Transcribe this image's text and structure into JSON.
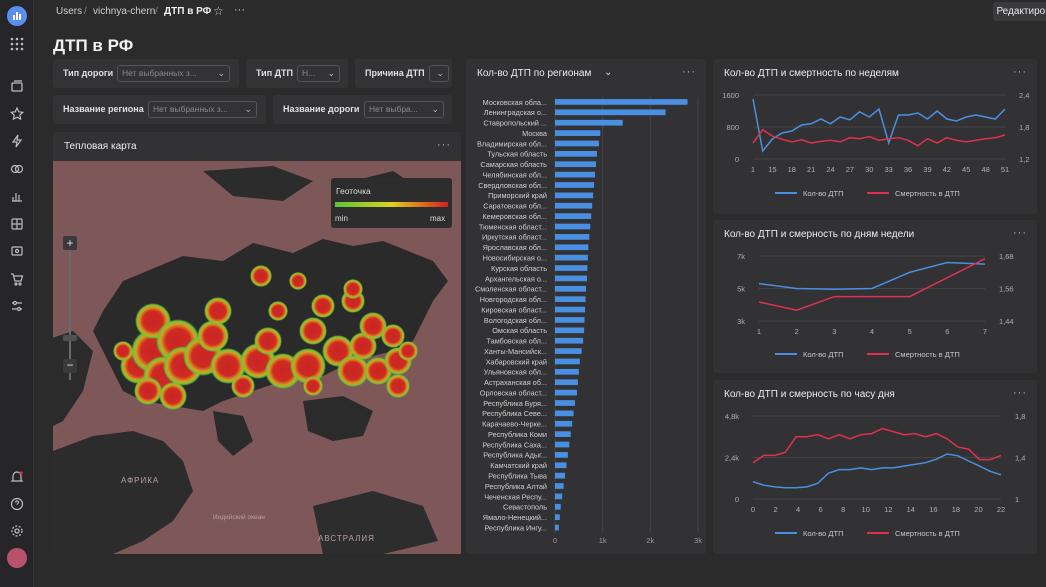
{
  "breadcrumbs": [
    "Users",
    "vichnya-chern",
    "ДТП в РФ"
  ],
  "topbar": {
    "edit_label": "Редактировать",
    "more_label": "···"
  },
  "page": {
    "title": "ДТП в РФ"
  },
  "filters": [
    {
      "label": "Тип дороги",
      "placeholder": "Нет выбранных з..."
    },
    {
      "label": "Тип ДТП",
      "placeholder": "Н..."
    },
    {
      "label": "Причина ДТП",
      "placeholder": ""
    },
    {
      "label": "Название региона",
      "placeholder": "Нет выбранных з..."
    },
    {
      "label": "Название дороги",
      "placeholder": "Нет выбра..."
    }
  ],
  "heatmap": {
    "title": "Тепловая карта",
    "legend_title": "Геоточка",
    "legend_min": "min",
    "legend_max": "max",
    "labels": [
      "АФРИКА",
      "Индийский океан",
      "АВСТРАЛИЯ"
    ],
    "colors": {
      "min": "#58c53a",
      "mid": "#e0d020",
      "max": "#d32020"
    }
  },
  "chart_data": [
    {
      "type": "bar",
      "title": "Кол-во ДТП по регионам",
      "orientation": "horizontal",
      "categories": [
        "Московская обла...",
        "Ленинградская о...",
        "Ставропольский ...",
        "Москва",
        "Владимирская обл...",
        "Тульская область",
        "Самарская область",
        "Челябинская обл...",
        "Свердловская обл...",
        "Приморский край",
        "Саратовская обл...",
        "Кемеровская обл...",
        "Тюменская област...",
        "Иркутская област...",
        "Ярославская обл...",
        "Новосибирская о...",
        "Курская область",
        "Архангельская о...",
        "Смоленская област...",
        "Новгородская обл...",
        "Кировская област...",
        "Вологодская обл...",
        "Омская область",
        "Тамбовская обл...",
        "Ханты-Мансийск...",
        "Хабаровский край",
        "Ульяновская обл...",
        "Астраханская об...",
        "Орловская област...",
        "Республика Буря...",
        "Республика Севе...",
        "Карачаево-Черке...",
        "Республика Коми",
        "Республика Саха...",
        "Республика Адыг...",
        "Камчатский край",
        "Республика Тыва",
        "Республика Алтай",
        "Чеченская Респу...",
        "Севастополь",
        "Ямало-Ненецкий...",
        "Республика Ингу..."
      ],
      "values": [
        2780,
        2320,
        1420,
        950,
        920,
        880,
        860,
        840,
        820,
        800,
        780,
        760,
        740,
        720,
        700,
        690,
        680,
        670,
        650,
        640,
        630,
        620,
        610,
        590,
        560,
        520,
        500,
        480,
        460,
        420,
        390,
        360,
        330,
        300,
        270,
        240,
        210,
        180,
        150,
        120,
        100,
        80
      ],
      "xticks": [
        "0",
        "1k",
        "2k",
        "3k"
      ],
      "xlim": [
        0,
        3000
      ]
    },
    {
      "type": "line",
      "title": "Кол-во ДТП и смертность по неделям",
      "x": [
        1,
        3,
        5,
        7,
        9,
        11,
        13,
        15,
        17,
        19,
        21,
        23,
        25,
        27,
        29,
        31,
        33,
        35,
        37,
        39,
        41,
        43,
        45,
        47,
        49,
        51,
        53
      ],
      "xticks": [
        "1",
        "15",
        "18",
        "21",
        "24",
        "27",
        "30",
        "33",
        "36",
        "39",
        "42",
        "45",
        "48",
        "51"
      ],
      "yticks_left": [
        "0",
        "800",
        "1600"
      ],
      "yticks_right": [
        "1,2",
        "1,8",
        "2,4"
      ],
      "ylim_left": [
        0,
        1600
      ],
      "ylim_right": [
        1.2,
        2.4
      ],
      "legend": "bottom-center",
      "series": [
        {
          "name": "Кол-во ДТП",
          "color": "#4a90e2",
          "axis": "left",
          "values": [
            1500,
            200,
            500,
            650,
            700,
            850,
            880,
            1000,
            880,
            1050,
            980,
            1180,
            1050,
            1250,
            400,
            1100,
            1100,
            1150,
            1000,
            1200,
            1000,
            950,
            1050,
            1100,
            1050,
            1000,
            1250
          ]
        },
        {
          "name": "Смертность в ДТП",
          "color": "#e03050",
          "axis": "right",
          "values": [
            1.5,
            1.75,
            1.63,
            1.57,
            1.52,
            1.56,
            1.5,
            1.53,
            1.55,
            1.52,
            1.6,
            1.58,
            1.62,
            1.55,
            1.58,
            1.6,
            1.55,
            1.45,
            1.58,
            1.5,
            1.6,
            1.55,
            1.52,
            1.55,
            1.58,
            1.6,
            1.65
          ]
        }
      ]
    },
    {
      "type": "line",
      "title": "Кол-во ДТП и смерность по дням недели",
      "x": [
        1,
        2,
        3,
        4,
        5,
        6,
        7
      ],
      "xticks": [
        "1",
        "2",
        "3",
        "4",
        "5",
        "6",
        "7"
      ],
      "yticks_left": [
        "3k",
        "5k",
        "7k"
      ],
      "yticks_right": [
        "1,44",
        "1,56",
        "1,68"
      ],
      "ylim_left": [
        3000,
        7000
      ],
      "ylim_right": [
        1.44,
        1.68
      ],
      "legend": "bottom-center",
      "series": [
        {
          "name": "Кол-во ДТП",
          "color": "#4a90e2",
          "axis": "left",
          "values": [
            5300,
            5000,
            4950,
            5000,
            6000,
            6600,
            6500
          ]
        },
        {
          "name": "Смертность в ДТП",
          "color": "#e03050",
          "axis": "right",
          "values": [
            1.51,
            1.48,
            1.53,
            1.53,
            1.53,
            1.6,
            1.67
          ]
        }
      ]
    },
    {
      "type": "line",
      "title": "Кол-во ДТП и смерность по часу дня",
      "x": [
        0,
        1,
        2,
        3,
        4,
        5,
        6,
        7,
        8,
        9,
        10,
        11,
        12,
        13,
        14,
        15,
        16,
        17,
        18,
        19,
        20,
        21,
        22,
        23
      ],
      "xticks": [
        "0",
        "2",
        "4",
        "6",
        "8",
        "10",
        "12",
        "14",
        "16",
        "18",
        "20",
        "22"
      ],
      "yticks_left": [
        "0",
        "2,4k",
        "4,8k"
      ],
      "yticks_right": [
        "1",
        "1,4",
        "1,8"
      ],
      "ylim_left": [
        0,
        4800
      ],
      "ylim_right": [
        1.0,
        1.8
      ],
      "legend": "bottom-center",
      "series": [
        {
          "name": "Кол-во ДТП",
          "color": "#4a90e2",
          "axis": "left",
          "values": [
            1000,
            800,
            700,
            650,
            650,
            700,
            900,
            1500,
            1700,
            1700,
            1800,
            1700,
            1800,
            1800,
            1900,
            2000,
            2100,
            2300,
            2600,
            2500,
            2200,
            1900,
            1600,
            1400
          ]
        },
        {
          "name": "Смертность в ДТП",
          "color": "#e03050",
          "axis": "right",
          "values": [
            1.35,
            1.42,
            1.42,
            1.45,
            1.6,
            1.6,
            1.62,
            1.58,
            1.62,
            1.58,
            1.62,
            1.63,
            1.68,
            1.65,
            1.62,
            1.63,
            1.6,
            1.63,
            1.58,
            1.5,
            1.48,
            1.38,
            1.38,
            1.42
          ]
        }
      ]
    }
  ]
}
